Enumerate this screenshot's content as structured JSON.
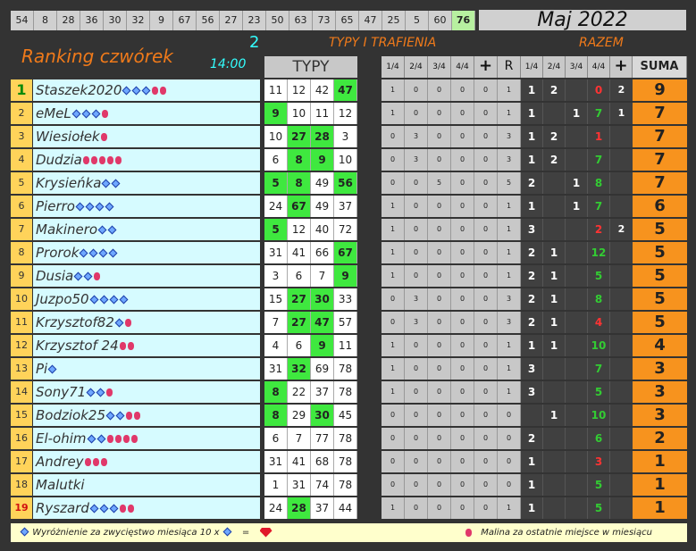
{
  "top_numbers": [
    "54",
    "8",
    "28",
    "36",
    "30",
    "32",
    "9",
    "67",
    "56",
    "27",
    "23",
    "50",
    "63",
    "73",
    "65",
    "47",
    "25",
    "5",
    "60",
    "76"
  ],
  "month": "Maj 2022",
  "header": {
    "ranking": "Ranking czwórek",
    "round": "2",
    "time": "14:00",
    "typy_trafienia": "TYPY I TRAFIENIA",
    "razem": "RAZEM",
    "typy": "TYPY",
    "mid_cols": [
      "1/4",
      "2/4",
      "3/4",
      "4/4",
      "+",
      "R"
    ],
    "razem_cols": [
      "1/4",
      "2/4",
      "3/4",
      "4/4",
      "+"
    ],
    "suma": "SUMA"
  },
  "rows": [
    {
      "rank": "1",
      "name": "Staszek2020",
      "dia": 3,
      "ber": 2,
      "typy": [
        "11",
        "12",
        "42",
        "47"
      ],
      "hits": [
        false,
        false,
        false,
        true
      ],
      "mid": [
        "1",
        "0",
        "0",
        "0",
        "0",
        "1"
      ],
      "rz": [
        "1",
        "2",
        "",
        "0",
        ""
      ],
      "plus": "2",
      "suma": "9"
    },
    {
      "rank": "2",
      "name": "eMeL",
      "dia": 3,
      "ber": 1,
      "typy": [
        "9",
        "10",
        "11",
        "12"
      ],
      "hits": [
        true,
        false,
        false,
        false
      ],
      "mid": [
        "1",
        "0",
        "0",
        "0",
        "0",
        "1"
      ],
      "rz": [
        "1",
        "",
        "1",
        "7",
        ""
      ],
      "plus": "1",
      "suma": "7"
    },
    {
      "rank": "3",
      "name": "Wiesiołek",
      "dia": 0,
      "ber": 1,
      "typy": [
        "10",
        "27",
        "28",
        "3"
      ],
      "hits": [
        false,
        true,
        true,
        false
      ],
      "mid": [
        "0",
        "3",
        "0",
        "0",
        "0",
        "3"
      ],
      "rz": [
        "1",
        "2",
        "",
        "1",
        ""
      ],
      "plus": "",
      "suma": "7"
    },
    {
      "rank": "4",
      "name": "Dudzia",
      "dia": 0,
      "ber": 5,
      "typy": [
        "6",
        "8",
        "9",
        "10"
      ],
      "hits": [
        false,
        true,
        true,
        false
      ],
      "mid": [
        "0",
        "3",
        "0",
        "0",
        "0",
        "3"
      ],
      "rz": [
        "1",
        "2",
        "",
        "7",
        ""
      ],
      "plus": "",
      "suma": "7"
    },
    {
      "rank": "5",
      "name": "Krysieńka",
      "dia": 2,
      "ber": 0,
      "typy": [
        "5",
        "8",
        "49",
        "56"
      ],
      "hits": [
        true,
        true,
        false,
        true
      ],
      "mid": [
        "0",
        "0",
        "5",
        "0",
        "0",
        "5"
      ],
      "rz": [
        "2",
        "",
        "1",
        "8",
        ""
      ],
      "plus": "",
      "suma": "7"
    },
    {
      "rank": "6",
      "name": "Pierro",
      "dia": 4,
      "ber": 0,
      "typy": [
        "24",
        "67",
        "49",
        "37"
      ],
      "hits": [
        false,
        true,
        false,
        false
      ],
      "mid": [
        "1",
        "0",
        "0",
        "0",
        "0",
        "1"
      ],
      "rz": [
        "1",
        "",
        "1",
        "7",
        ""
      ],
      "plus": "",
      "suma": "6"
    },
    {
      "rank": "7",
      "name": "Makinero",
      "dia": 2,
      "ber": 0,
      "typy": [
        "5",
        "12",
        "40",
        "72"
      ],
      "hits": [
        true,
        false,
        false,
        false
      ],
      "mid": [
        "1",
        "0",
        "0",
        "0",
        "0",
        "1"
      ],
      "rz": [
        "3",
        "",
        "",
        "2",
        ""
      ],
      "plus": "2",
      "suma": "5"
    },
    {
      "rank": "8",
      "name": "Prorok",
      "dia": 4,
      "ber": 0,
      "typy": [
        "31",
        "41",
        "66",
        "67"
      ],
      "hits": [
        false,
        false,
        false,
        true
      ],
      "mid": [
        "1",
        "0",
        "0",
        "0",
        "0",
        "1"
      ],
      "rz": [
        "2",
        "1",
        "",
        "12",
        ""
      ],
      "plus": "",
      "suma": "5"
    },
    {
      "rank": "9",
      "name": "Dusia",
      "dia": 2,
      "ber": 1,
      "typy": [
        "3",
        "6",
        "7",
        "9"
      ],
      "hits": [
        false,
        false,
        false,
        true
      ],
      "mid": [
        "1",
        "0",
        "0",
        "0",
        "0",
        "1"
      ],
      "rz": [
        "2",
        "1",
        "",
        "5",
        ""
      ],
      "plus": "",
      "suma": "5"
    },
    {
      "rank": "10",
      "name": "Juzpo50",
      "dia": 4,
      "ber": 0,
      "typy": [
        "15",
        "27",
        "30",
        "33"
      ],
      "hits": [
        false,
        true,
        true,
        false
      ],
      "mid": [
        "0",
        "3",
        "0",
        "0",
        "0",
        "3"
      ],
      "rz": [
        "2",
        "1",
        "",
        "8",
        ""
      ],
      "plus": "",
      "suma": "5"
    },
    {
      "rank": "11",
      "name": "Krzysztof82",
      "dia": 1,
      "ber": 1,
      "typy": [
        "7",
        "27",
        "47",
        "57"
      ],
      "hits": [
        false,
        true,
        true,
        false
      ],
      "mid": [
        "0",
        "3",
        "0",
        "0",
        "0",
        "3"
      ],
      "rz": [
        "2",
        "1",
        "",
        "4",
        ""
      ],
      "plus": "",
      "suma": "5"
    },
    {
      "rank": "12",
      "name": "Krzysztof 24",
      "dia": 0,
      "ber": 2,
      "typy": [
        "4",
        "6",
        "9",
        "11"
      ],
      "hits": [
        false,
        false,
        true,
        false
      ],
      "mid": [
        "1",
        "0",
        "0",
        "0",
        "0",
        "1"
      ],
      "rz": [
        "1",
        "1",
        "",
        "10",
        ""
      ],
      "plus": "",
      "suma": "4"
    },
    {
      "rank": "13",
      "name": "Pi",
      "dia": 1,
      "ber": 0,
      "typy": [
        "31",
        "32",
        "69",
        "78"
      ],
      "hits": [
        false,
        true,
        false,
        false
      ],
      "mid": [
        "1",
        "0",
        "0",
        "0",
        "0",
        "1"
      ],
      "rz": [
        "3",
        "",
        "",
        "7",
        ""
      ],
      "plus": "",
      "suma": "3"
    },
    {
      "rank": "14",
      "name": "Sony71",
      "dia": 2,
      "ber": 1,
      "typy": [
        "8",
        "22",
        "37",
        "78"
      ],
      "hits": [
        true,
        false,
        false,
        false
      ],
      "mid": [
        "1",
        "0",
        "0",
        "0",
        "0",
        "1"
      ],
      "rz": [
        "3",
        "",
        "",
        "5",
        ""
      ],
      "plus": "",
      "suma": "3"
    },
    {
      "rank": "15",
      "name": "Bodziok25",
      "dia": 2,
      "ber": 2,
      "typy": [
        "8",
        "29",
        "30",
        "45"
      ],
      "hits": [
        true,
        false,
        true,
        false
      ],
      "mid": [
        "0",
        "0",
        "0",
        "0",
        "0",
        "0"
      ],
      "rz": [
        "",
        "1",
        "",
        "10",
        ""
      ],
      "plus": "",
      "suma": "3"
    },
    {
      "rank": "16",
      "name": "El-ohim",
      "dia": 2,
      "ber": 4,
      "typy": [
        "6",
        "7",
        "77",
        "78"
      ],
      "hits": [
        false,
        false,
        false,
        false
      ],
      "mid": [
        "0",
        "0",
        "0",
        "0",
        "0",
        "0"
      ],
      "rz": [
        "2",
        "",
        "",
        "6",
        ""
      ],
      "plus": "",
      "suma": "2"
    },
    {
      "rank": "17",
      "name": "Andrey",
      "dia": 0,
      "ber": 3,
      "typy": [
        "31",
        "41",
        "68",
        "78"
      ],
      "hits": [
        false,
        false,
        false,
        false
      ],
      "mid": [
        "0",
        "0",
        "0",
        "0",
        "0",
        "0"
      ],
      "rz": [
        "1",
        "",
        "",
        "3",
        ""
      ],
      "plus": "",
      "suma": "1"
    },
    {
      "rank": "18",
      "name": "Malutki",
      "dia": 0,
      "ber": 0,
      "typy": [
        "1",
        "31",
        "74",
        "78"
      ],
      "hits": [
        false,
        false,
        false,
        false
      ],
      "mid": [
        "0",
        "0",
        "0",
        "0",
        "0",
        "0"
      ],
      "rz": [
        "1",
        "",
        "",
        "5",
        ""
      ],
      "plus": "",
      "suma": "1"
    },
    {
      "rank": "19",
      "name": "Ryszard",
      "dia": 3,
      "ber": 2,
      "typy": [
        "24",
        "28",
        "37",
        "44"
      ],
      "hits": [
        false,
        true,
        false,
        false
      ],
      "mid": [
        "1",
        "0",
        "0",
        "0",
        "0",
        "1"
      ],
      "rz": [
        "1",
        "",
        "",
        "5",
        ""
      ],
      "plus": "",
      "suma": "1"
    }
  ],
  "footer": {
    "left": "Wyróżnienie za zwycięstwo miesiąca  10 x",
    "eq": "=",
    "right": "Malina za ostatnie miejsce w miesiącu"
  }
}
